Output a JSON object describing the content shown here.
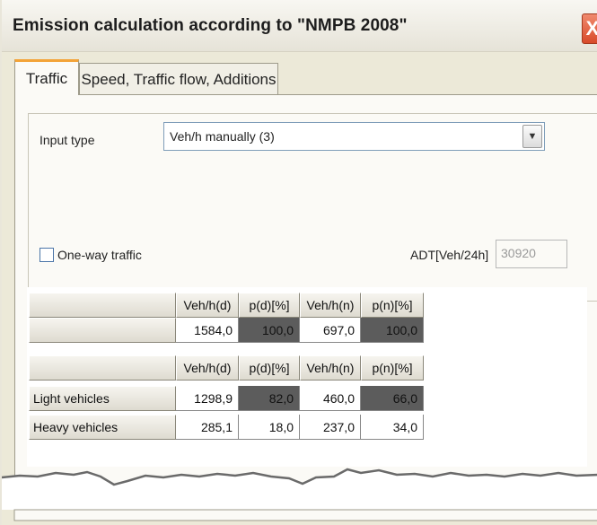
{
  "window": {
    "title": "Emission calculation according to \"NMPB 2008\"",
    "close_glyph": "X"
  },
  "tabs": [
    {
      "label": "Traffic"
    },
    {
      "label": "Speed, Traffic flow, Additions"
    }
  ],
  "input_type": {
    "label": "Input type",
    "value": "Veh/h manually (3)",
    "arrow": "▼"
  },
  "oneway": {
    "label": "One-way traffic",
    "checked": false
  },
  "adt": {
    "label": "ADT[Veh/24h]",
    "value": "30920"
  },
  "total_table": {
    "headers": [
      "Veh/h(d)",
      "p(d)[%]",
      "Veh/h(n)",
      "p(n)[%]"
    ],
    "row": {
      "label": "",
      "values": [
        "1584,0",
        "100,0",
        "697,0",
        "100,0"
      ]
    }
  },
  "vehicle_table": {
    "headers": [
      "Veh/h(d)",
      "p(d)[%]",
      "Veh/h(n)",
      "p(n)[%]"
    ],
    "rows": [
      {
        "label": "Light vehicles",
        "values": [
          "1298,9",
          "82,0",
          "460,0",
          "66,0"
        ]
      },
      {
        "label": "Heavy vehicles",
        "values": [
          "285,1",
          "18,0",
          "237,0",
          "34,0"
        ]
      }
    ]
  }
}
